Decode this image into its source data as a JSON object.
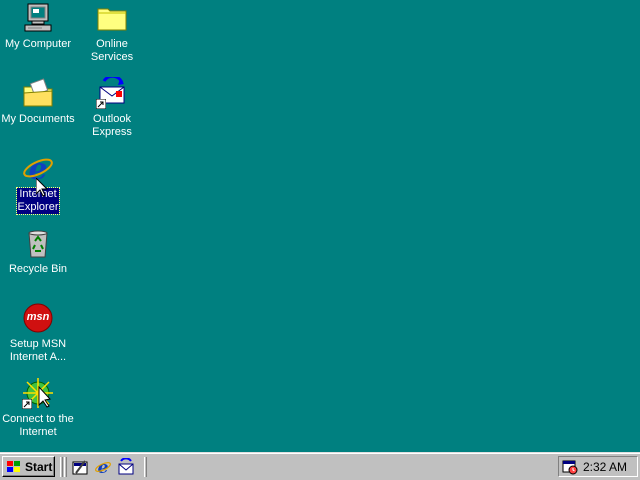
{
  "desktop": {
    "background_color": "#008080",
    "icons": {
      "my_computer": {
        "label": "My Computer",
        "icon": "computer-icon"
      },
      "online_services": {
        "label": "Online\nServices",
        "icon": "folder-icon"
      },
      "my_documents": {
        "label": "My Documents",
        "icon": "documents-folder-icon"
      },
      "outlook_express": {
        "label": "Outlook\nExpress",
        "icon": "outlook-express-icon"
      },
      "internet_explorer": {
        "label": "Internet\nExplorer",
        "icon": "internet-explorer-icon",
        "selected": true
      },
      "recycle_bin": {
        "label": "Recycle Bin",
        "icon": "recycle-bin-icon"
      },
      "setup_msn": {
        "label": "Setup MSN\nInternet A...",
        "icon": "msn-icon",
        "badge_text": "msn"
      },
      "connect_internet": {
        "label": "Connect to the\nInternet",
        "icon": "connect-wizard-icon"
      }
    }
  },
  "taskbar": {
    "start_label": "Start",
    "quick_launch": [
      "show-desktop-icon",
      "internet-explorer-icon",
      "outlook-express-icon"
    ],
    "tray": {
      "time": "2:32 AM",
      "icon": "scheduler-icon"
    }
  }
}
